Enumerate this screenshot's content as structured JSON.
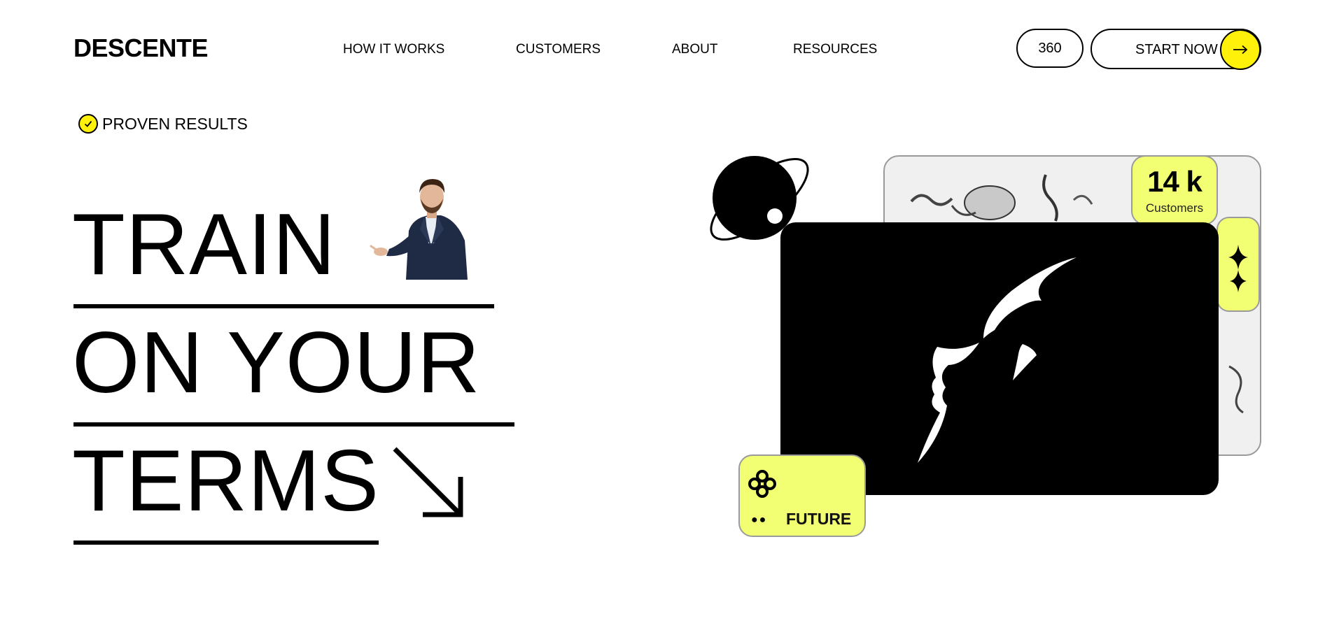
{
  "brand": "DESCENTE",
  "nav": [
    {
      "label": "HOW IT WORKS"
    },
    {
      "label": "CUSTOMERS"
    },
    {
      "label": "ABOUT"
    },
    {
      "label": "RESOURCES"
    }
  ],
  "header": {
    "pill_label": "360",
    "cta_label": "START NOW",
    "cta_icon": "arrow-right-icon"
  },
  "hero": {
    "badge": "PROVEN RESULTS",
    "badge_icon": "check-circle-icon",
    "lines": [
      "TRAIN",
      "ON YOUR",
      "TERMS"
    ],
    "arrow_icon": "arrow-down-right-icon"
  },
  "cards": {
    "stat_value": "14 k",
    "stat_label": "Customers",
    "tag_label": "FUTURE"
  },
  "colors": {
    "accent": "#fff10a",
    "card_accent": "#f3ff73",
    "text": "#000000",
    "background": "#ffffff"
  }
}
